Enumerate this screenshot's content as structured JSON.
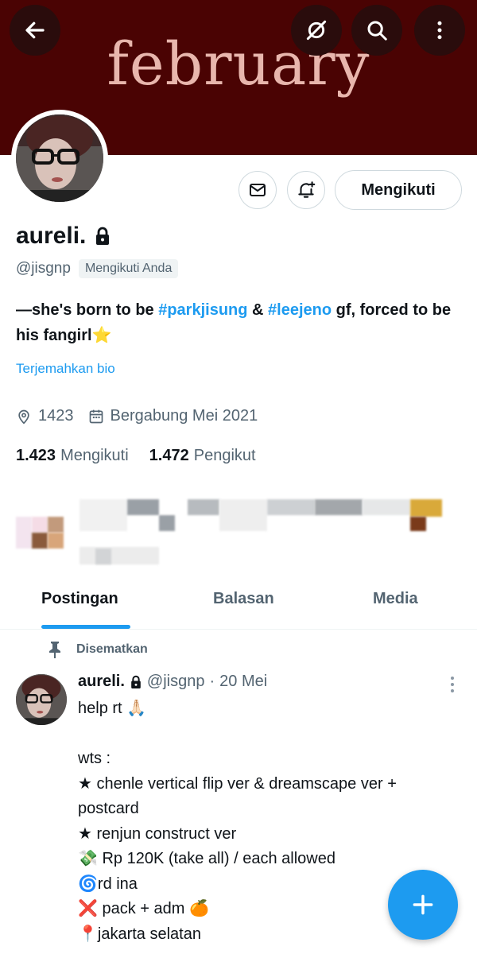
{
  "banner": {
    "text": "february",
    "background": "#4a0303",
    "text_color": "#e8b6ad"
  },
  "top_bar": {
    "back_icon": "arrow-left-icon",
    "grok_icon": "grok-icon",
    "search_icon": "search-icon",
    "more_icon": "more-vertical-icon"
  },
  "profile": {
    "display_name": "aureli.",
    "protected_icon": "lock-icon",
    "handle": "@jisgnp",
    "follows_you": "Mengikuti Anda",
    "bio": {
      "part1": "—she's born to be ",
      "tag1": "#parkjisung",
      "part2": " & ",
      "tag2": "#leejeno",
      "part3": " gf, forced to be his fangirl",
      "emoji": "⭐"
    },
    "translate_bio": "Terjemahkan bio",
    "location": "1423",
    "joined": "Bergabung Mei 2021",
    "following_count": "1.423",
    "following_label": "Mengikuti",
    "followers_count": "1.472",
    "followers_label": "Pengikut"
  },
  "actions": {
    "message_icon": "envelope-icon",
    "notify_icon": "bell-plus-icon",
    "follow_label": "Mengikuti"
  },
  "tabs": [
    {
      "label": "Postingan",
      "active": true
    },
    {
      "label": "Balasan",
      "active": false
    },
    {
      "label": "Media",
      "active": false
    }
  ],
  "pinned_post": {
    "pinned_label": "Disematkan",
    "author_name": "aureli.",
    "author_handle": "@jisgnp",
    "date": "20 Mei",
    "lines": [
      "help rt 🙏🏻",
      "",
      "wts :",
      "★ chenle vertical flip ver & dreamscape ver +",
      "postcard",
      "★ renjun construct ver",
      "💸 Rp 120K (take all) / each allowed",
      "🌀rd ina",
      "❌ pack + adm 🍊",
      "📍jakarta selatan"
    ]
  },
  "fab": {
    "icon": "plus-icon"
  },
  "colors": {
    "accent": "#1d9bf0",
    "text": "#0f1419",
    "secondary": "#536471"
  }
}
